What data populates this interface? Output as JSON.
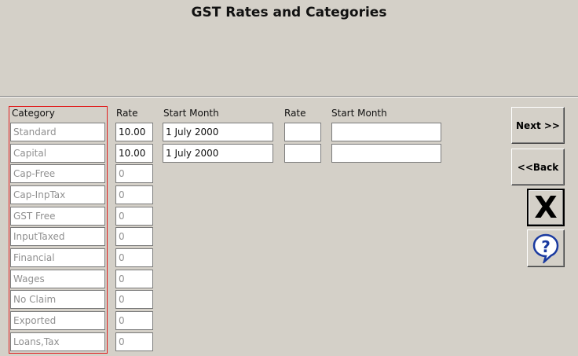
{
  "title": "GST Rates and Categories",
  "headers": {
    "category": "Category",
    "rate": "Rate",
    "start_month": "Start Month",
    "rate2": "Rate",
    "start_month2": "Start Month"
  },
  "rows": [
    {
      "category": "Standard",
      "rate": "10.00",
      "start": "1 July 2000",
      "rate2": "",
      "start2": ""
    },
    {
      "category": "Capital",
      "rate": "10.00",
      "start": "1 July 2000",
      "rate2": "",
      "start2": ""
    },
    {
      "category": "Cap-Free",
      "rate": "0"
    },
    {
      "category": "Cap-InpTax",
      "rate": "0"
    },
    {
      "category": "GST Free",
      "rate": "0"
    },
    {
      "category": "InputTaxed",
      "rate": "0"
    },
    {
      "category": "Financial",
      "rate": "0"
    },
    {
      "category": "Wages",
      "rate": "0"
    },
    {
      "category": "No Claim",
      "rate": "0"
    },
    {
      "category": "Exported",
      "rate": "0"
    },
    {
      "category": "Loans,Tax",
      "rate": "0"
    }
  ],
  "buttons": {
    "next": "Next >>",
    "back": "<<Back",
    "close_icon": "close-x-icon",
    "help_icon": "help-question-icon"
  },
  "colors": {
    "background": "#d4d0c8",
    "category_frame": "#e02020",
    "help_icon": "#1a3aa0"
  }
}
